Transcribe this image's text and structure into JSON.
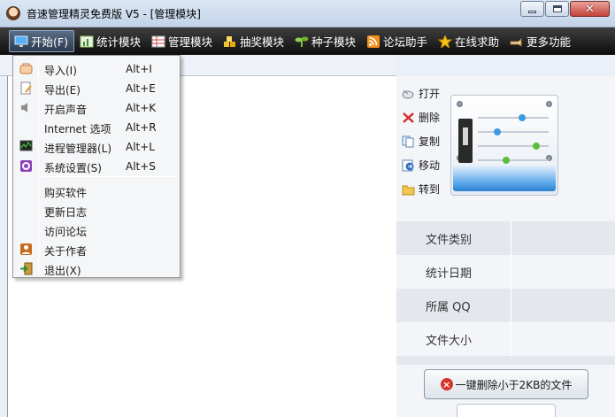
{
  "window": {
    "title": "音速管理精灵免费版 V5 - [管理模块]",
    "controls": {
      "minimize": "minimize-icon",
      "maximize": "maximize-icon",
      "close": "close-icon"
    }
  },
  "toolbar": {
    "items": [
      {
        "label": "开始(F)",
        "icon": "monitor-icon",
        "active": true
      },
      {
        "label": "统计模块",
        "icon": "chart-icon"
      },
      {
        "label": "管理模块",
        "icon": "grid-icon"
      },
      {
        "label": "抽奖模块",
        "icon": "gold-icon"
      },
      {
        "label": "种子模块",
        "icon": "seedling-icon"
      },
      {
        "label": "论坛助手",
        "icon": "rss-icon"
      },
      {
        "label": "在线求助",
        "icon": "star-icon"
      },
      {
        "label": "更多功能",
        "icon": "hand-icon"
      }
    ]
  },
  "menu": {
    "items": [
      {
        "label": "导入(I)",
        "shortcut": "Alt+I",
        "icon": "import-icon"
      },
      {
        "label": "导出(E)",
        "shortcut": "Alt+E",
        "icon": "export-icon"
      },
      {
        "label": "开启声音",
        "shortcut": "Alt+K",
        "icon": "speaker-icon"
      },
      {
        "label": "Internet 选项",
        "shortcut": "Alt+R",
        "icon": ""
      },
      {
        "label": "进程管理器(L)",
        "shortcut": "Alt+L",
        "icon": "monitor-chart-icon"
      },
      {
        "label": "系统设置(S)",
        "shortcut": "Alt+S",
        "icon": "settings-icon"
      },
      {
        "label": "购买软件",
        "shortcut": "",
        "icon": ""
      },
      {
        "label": "更新日志",
        "shortcut": "",
        "icon": ""
      },
      {
        "label": "访问论坛",
        "shortcut": "",
        "icon": ""
      },
      {
        "label": "关于作者",
        "shortcut": "",
        "icon": "user-icon"
      },
      {
        "label": "退出(X)",
        "shortcut": "",
        "icon": "exit-icon"
      }
    ]
  },
  "actions": [
    {
      "label": "打开",
      "icon": "open-icon"
    },
    {
      "label": "删除",
      "icon": "delete-x-icon"
    },
    {
      "label": "复制",
      "icon": "copy-icon"
    },
    {
      "label": "移动",
      "icon": "move-icon"
    },
    {
      "label": "转到",
      "icon": "folder-icon"
    }
  ],
  "info": {
    "rows": [
      "文件类别",
      "统计日期",
      "所属 QQ",
      "文件大小"
    ]
  },
  "delete_button": {
    "label": "一键删除小于2KB的文件",
    "icon": "delete-circle-icon"
  },
  "colors": {
    "toolbar_bg": "#1a1a1a",
    "title_bg": "#c9d8ec",
    "menu_bg": "#f5f6f7",
    "accent_blue": "#2b7fd1"
  }
}
